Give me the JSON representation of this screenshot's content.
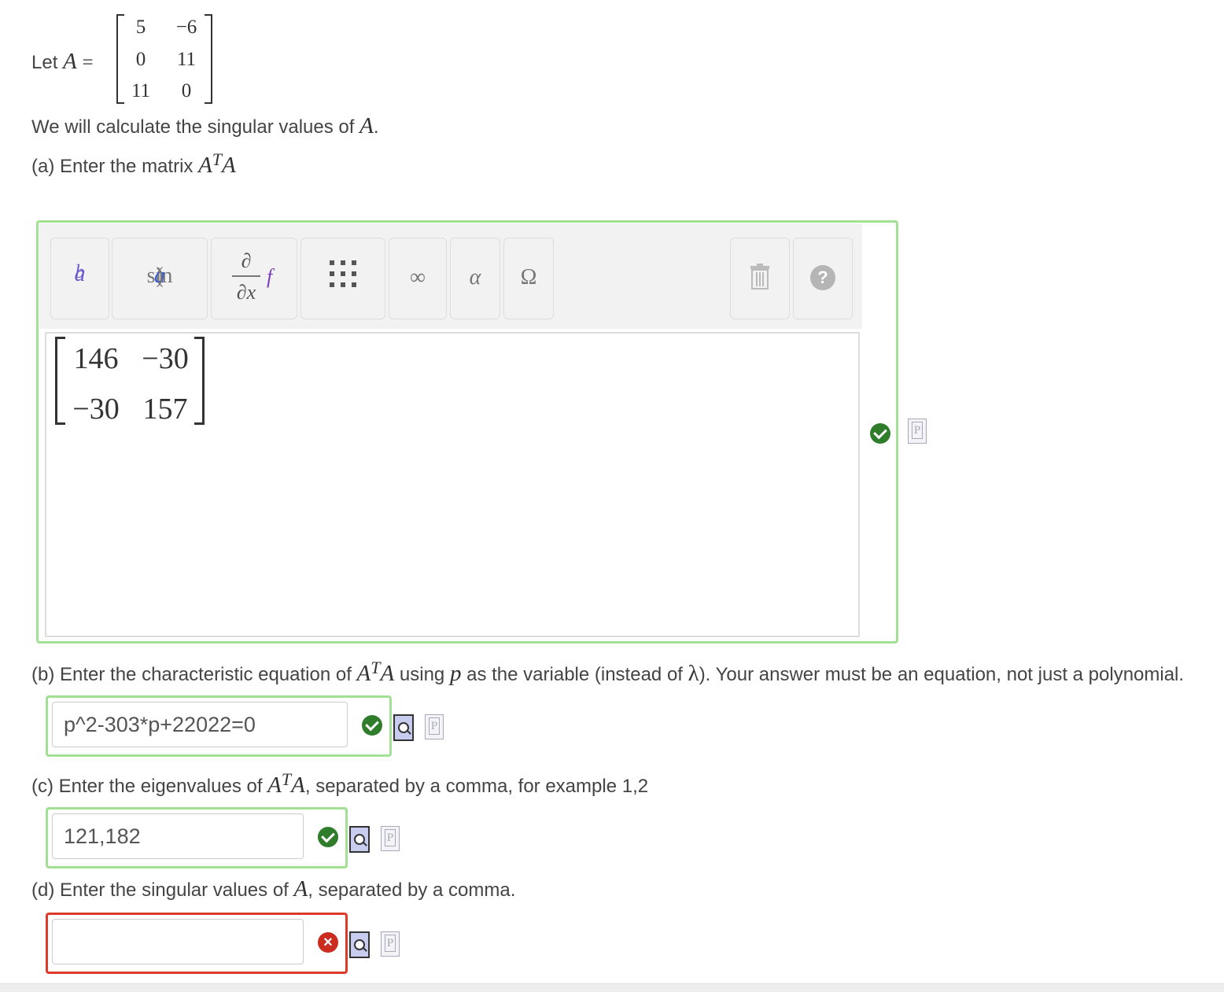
{
  "intro": {
    "let_label": "Let",
    "var_A": "A",
    "equals": "=",
    "matrix_A": [
      [
        "5",
        "−6"
      ],
      [
        "0",
        "11"
      ],
      [
        "11",
        "0"
      ]
    ],
    "statement_prefix": "We will calculate the singular values of",
    "statement_var": "A",
    "statement_suffix": "."
  },
  "part_a": {
    "prefix": "(a) Enter the matrix",
    "base1": "A",
    "sup": "T",
    "base2": "A",
    "toolbar": {
      "power_base": "a",
      "power_exp": "b",
      "sin_fn": "sin",
      "sin_open": "(",
      "sin_arg": "a",
      "sin_close": ")",
      "deriv_num": "∂",
      "deriv_den": "∂x",
      "deriv_f": "f",
      "infinity": "∞",
      "alpha": "α",
      "omega": "Ω",
      "help": "?"
    },
    "answer_matrix": [
      [
        "146",
        "−30"
      ],
      [
        "−30",
        "157"
      ]
    ],
    "status": "correct"
  },
  "part_b": {
    "prefix": "(b) Enter the characteristic equation of",
    "base1": "A",
    "sup": "T",
    "base2": "A",
    "mid1": "using",
    "var_p": "p",
    "mid2": "as the variable (instead of",
    "lambda": "λ",
    "suffix": "). Your answer must be an equation, not just a polynomial.",
    "answer": "p^2-303*p+22022=0",
    "status": "correct"
  },
  "part_c": {
    "prefix": "(c) Enter the eigenvalues of",
    "base1": "A",
    "sup": "T",
    "base2": "A",
    "suffix": ", separated by a comma, for example 1,2",
    "answer": "121,182",
    "status": "correct"
  },
  "part_d": {
    "prefix": "(d) Enter the singular values of",
    "var_A": "A",
    "suffix": ", separated by a comma.",
    "answer": "",
    "status": "incorrect"
  },
  "icons": {
    "p_label": "P",
    "x_mark": "×"
  },
  "colors": {
    "correct_border": "#a2e094",
    "incorrect_border": "#dd3a2a",
    "check_green": "#2f7d2b",
    "x_red": "#cc2b1f"
  }
}
